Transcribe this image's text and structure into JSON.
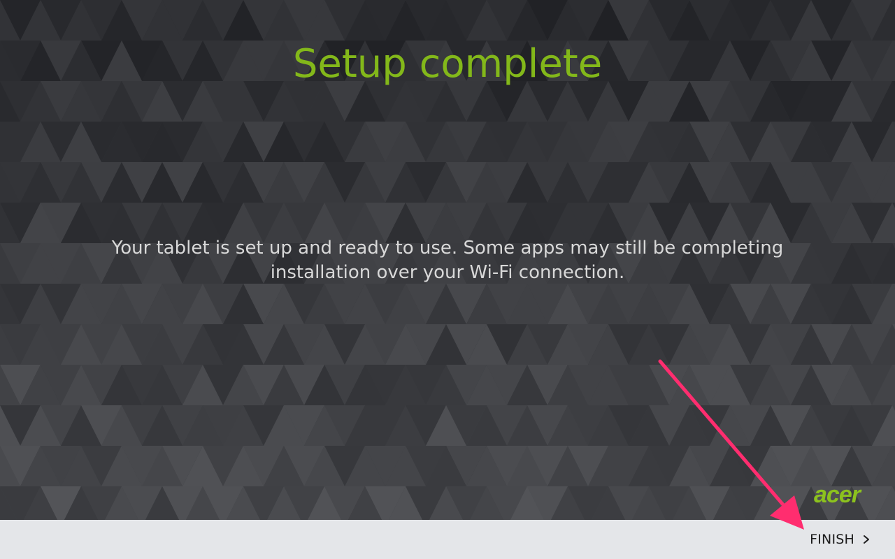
{
  "setup": {
    "title": "Setup complete",
    "message": "Your tablet is set up and ready to use. Some apps may still be completing installation over your Wi-Fi connection."
  },
  "brand": {
    "logo_text": "acer",
    "icon": "acer-logo"
  },
  "footer": {
    "finish_label": "FINISH",
    "finish_icon": "chevron-right-icon"
  },
  "annotation": {
    "icon": "pointer-arrow",
    "color": "#ff2d6f"
  },
  "colors": {
    "title": "#83b81a",
    "logo": "#8cc21e",
    "background": "#3b3c40",
    "bottom_bar": "#e4e6e9"
  }
}
